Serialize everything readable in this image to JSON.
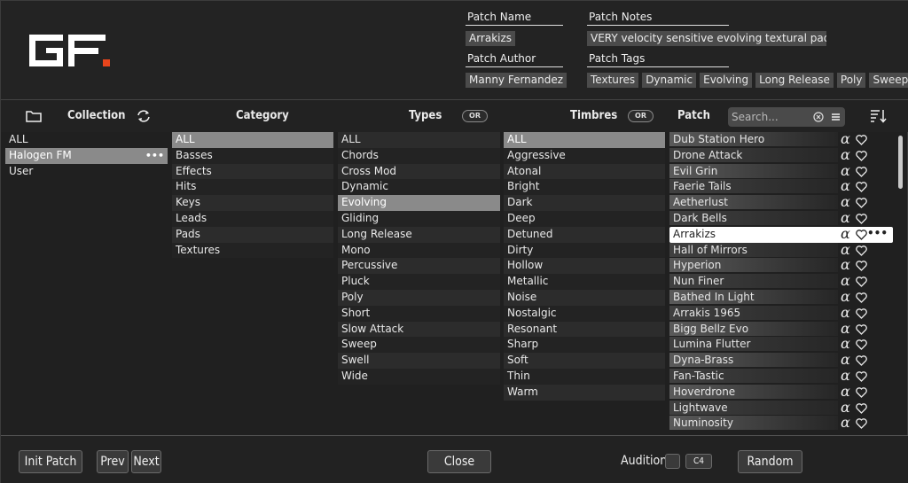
{
  "header": {
    "patch_name_label": "Patch Name",
    "patch_name_value": "Arrakizs",
    "patch_notes_label": "Patch Notes",
    "patch_notes_value": "VERY velocity sensitive evolving textural pad/  A...",
    "patch_author_label": "Patch Author",
    "patch_author_value": "Manny Fernandez",
    "patch_tags_label": "Patch Tags",
    "patch_tags": [
      "Textures",
      "Dynamic",
      "Evolving",
      "Long Release",
      "Poly",
      "Sweep"
    ],
    "logo": "GF",
    "accent_color": "#e8451c"
  },
  "columns": {
    "collection_label": "Collection",
    "category_label": "Category",
    "types_label": "Types",
    "types_or": "OR",
    "timbres_label": "Timbres",
    "timbres_or": "OR",
    "patch_label": "Patch",
    "search_placeholder": "Search..."
  },
  "collection": {
    "items": [
      {
        "label": "ALL",
        "selected": false
      },
      {
        "label": "Halogen FM",
        "selected": true,
        "more": "•••"
      },
      {
        "label": "User",
        "selected": false
      }
    ]
  },
  "category": {
    "items": [
      "ALL",
      "Basses",
      "Effects",
      "Hits",
      "Keys",
      "Leads",
      "Pads",
      "Textures"
    ],
    "selected": "ALL"
  },
  "types": {
    "items": [
      "ALL",
      "Chords",
      "Cross Mod",
      "Dynamic",
      "Evolving",
      "Gliding",
      "Long Release",
      "Mono",
      "Percussive",
      "Pluck",
      "Poly",
      "Short",
      "Slow Attack",
      "Sweep",
      "Swell",
      "Wide"
    ],
    "selected": "Evolving"
  },
  "timbres": {
    "items": [
      "ALL",
      "Aggressive",
      "Atonal",
      "Bright",
      "Dark",
      "Deep",
      "Detuned",
      "Dirty",
      "Hollow",
      "Metallic",
      "Noise",
      "Nostalgic",
      "Resonant",
      "Sharp",
      "Soft",
      "Thin",
      "Warm"
    ],
    "selected": "ALL"
  },
  "patches": {
    "items": [
      "Dub Station Hero",
      "Drone Attack",
      "Evil Grin",
      "Faerie Tails",
      "Aetherlust",
      "Dark Bells",
      "Arrakizs",
      "Hall of Mirrors",
      "Hyperion",
      "Nun Finer",
      "Bathed In Light",
      "Arrakis 1965",
      "Bigg Bellz Evo",
      "Lumina Flutter",
      "Dyna-Brass",
      "Fan-Tastic",
      "Hoverdrone",
      "Lightwave",
      "Numinosity"
    ],
    "active": "Arrakizs",
    "alpha_symbol": "α",
    "more": "•••"
  },
  "footer": {
    "init_patch": "Init Patch",
    "prev": "Prev",
    "next": "Next",
    "close": "Close",
    "audition": "Audition",
    "audition_note": "C4",
    "random": "Random"
  }
}
